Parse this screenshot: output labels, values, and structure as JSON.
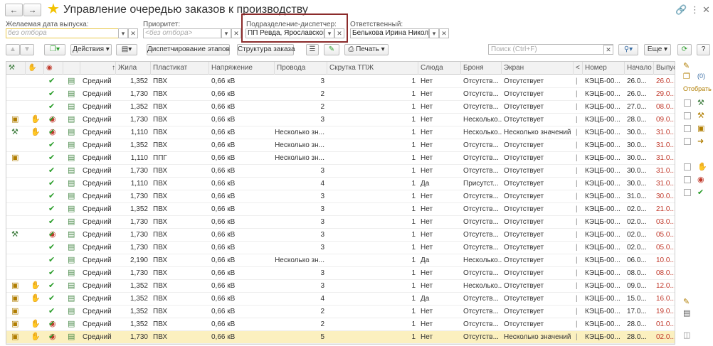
{
  "window": {
    "title": "Управление очередью заказов к производству",
    "back_icon": "arrow-left-icon",
    "forward_icon": "arrow-right-icon"
  },
  "filters": {
    "date": {
      "label": "Желаемая дата выпуска:",
      "placeholder": "без отбора"
    },
    "priority": {
      "label": "Приоритет:",
      "placeholder": "<без отбора>"
    },
    "department": {
      "label": "Подразделение-диспетчер:",
      "value": "ПП Ревда, Ярославского"
    },
    "responsible": {
      "label": "Ответственный:",
      "value": "Белькова Ирина Николаев"
    }
  },
  "toolbar": {
    "actions": "Действия",
    "dispatch": "Диспетчирование этапов",
    "structure": "Структура заказа",
    "print": "Печать",
    "search_placeholder": "Поиск (Ctrl+F)",
    "more": "Еще"
  },
  "columns": [
    "",
    "",
    "",
    "",
    "↑",
    "Жила",
    "Пластикат",
    "Напряжение",
    "Провода",
    "Скрутка ТПЖ",
    "Слюда",
    "Броня",
    "Экран",
    "<",
    "Номер",
    "Начало",
    "Выпуск"
  ],
  "rows": [
    {
      "i1": "",
      "i2": "",
      "i3": "",
      "prio": "Средний",
      "zhila": "1,352",
      "plast": "ПВХ",
      "volt": "0,66 кВ",
      "wires": "3",
      "twist": "1",
      "mica": "Нет",
      "armor": "Отсутств...",
      "screen": "Отсутствует",
      "num": "КЭЦБ-00...",
      "start": "26.0...",
      "release": "26.0..."
    },
    {
      "i1": "",
      "i2": "",
      "i3": "",
      "prio": "Средний",
      "zhila": "1,730",
      "plast": "ПВХ",
      "volt": "0,66 кВ",
      "wires": "2",
      "twist": "1",
      "mica": "Нет",
      "armor": "Отсутств...",
      "screen": "Отсутствует",
      "num": "КЭЦБ-00...",
      "start": "26.0...",
      "release": "29.0..."
    },
    {
      "i1": "",
      "i2": "",
      "i3": "",
      "prio": "Средний",
      "zhila": "1,352",
      "plast": "ПВХ",
      "volt": "0,66 кВ",
      "wires": "2",
      "twist": "1",
      "mica": "Нет",
      "armor": "Отсутств...",
      "screen": "Отсутствует",
      "num": "КЭЦБ-00...",
      "start": "27.0...",
      "release": "08.0..."
    },
    {
      "i1": "cal",
      "i2": "hand",
      "i3": "money",
      "prio": "Средний",
      "zhila": "1,730",
      "plast": "ПВХ",
      "volt": "0,66 кВ",
      "wires": "3",
      "twist": "1",
      "mica": "Нет",
      "armor": "Несколько...",
      "screen": "Отсутствует",
      "num": "КЭЦБ-00...",
      "start": "28.0...",
      "release": "09.0..."
    },
    {
      "i1": "tool",
      "i2": "hand",
      "i3": "money",
      "prio": "Средний",
      "zhila": "1,110",
      "plast": "ПВХ",
      "volt": "0,66 кВ",
      "wires": "Несколько зн...",
      "twist": "1",
      "mica": "Нет",
      "armor": "Несколько...",
      "screen": "Несколько значений",
      "num": "КЭЦБ-00...",
      "start": "30.0...",
      "release": "31.0..."
    },
    {
      "i1": "",
      "i2": "",
      "i3": "",
      "prio": "Средний",
      "zhila": "1,352",
      "plast": "ПВХ",
      "volt": "0,66 кВ",
      "wires": "Несколько зн...",
      "twist": "1",
      "mica": "Нет",
      "armor": "Отсутств...",
      "screen": "Отсутствует",
      "num": "КЭЦБ-00...",
      "start": "30.0...",
      "release": "31.0..."
    },
    {
      "i1": "cal",
      "i2": "",
      "i3": "",
      "prio": "Средний",
      "zhila": "1,110",
      "plast": "ППГ",
      "volt": "0,66 кВ",
      "wires": "Несколько зн...",
      "twist": "1",
      "mica": "Нет",
      "armor": "Отсутств...",
      "screen": "Отсутствует",
      "num": "КЭЦБ-00...",
      "start": "30.0...",
      "release": "31.0..."
    },
    {
      "i1": "",
      "i2": "",
      "i3": "",
      "prio": "Средний",
      "zhila": "1,730",
      "plast": "ПВХ",
      "volt": "0,66 кВ",
      "wires": "3",
      "twist": "1",
      "mica": "Нет",
      "armor": "Отсутств...",
      "screen": "Отсутствует",
      "num": "КЭЦБ-00...",
      "start": "30.0...",
      "release": "31.0..."
    },
    {
      "i1": "",
      "i2": "",
      "i3": "",
      "prio": "Средний",
      "zhila": "1,110",
      "plast": "ПВХ",
      "volt": "0,66 кВ",
      "wires": "4",
      "twist": "1",
      "mica": "Да",
      "armor": "Присутст...",
      "screen": "Отсутствует",
      "num": "КЭЦБ-00...",
      "start": "30.0...",
      "release": "31.0..."
    },
    {
      "i1": "",
      "i2": "",
      "i3": "",
      "prio": "Средний",
      "zhila": "1,730",
      "plast": "ПВХ",
      "volt": "0,66 кВ",
      "wires": "3",
      "twist": "1",
      "mica": "Нет",
      "armor": "Отсутств...",
      "screen": "Отсутствует",
      "num": "КЭЦБ-00...",
      "start": "31.0...",
      "release": "30.0..."
    },
    {
      "i1": "",
      "i2": "",
      "i3": "",
      "prio": "Средний",
      "zhila": "1,352",
      "plast": "ПВХ",
      "volt": "0,66 кВ",
      "wires": "3",
      "twist": "1",
      "mica": "Нет",
      "armor": "Отсутств...",
      "screen": "Отсутствует",
      "num": "КЭЦБ-00...",
      "start": "02.0...",
      "release": "21.0..."
    },
    {
      "i1": "",
      "i2": "",
      "i3": "",
      "prio": "Средний",
      "zhila": "1,730",
      "plast": "ПВХ",
      "volt": "0,66 кВ",
      "wires": "3",
      "twist": "1",
      "mica": "Нет",
      "armor": "Отсутств...",
      "screen": "Отсутствует",
      "num": "КЭЦБ-00...",
      "start": "02.0...",
      "release": "03.0..."
    },
    {
      "i1": "tool",
      "i2": "",
      "i3": "money",
      "prio": "Средний",
      "zhila": "1,730",
      "plast": "ПВХ",
      "volt": "0,66 кВ",
      "wires": "3",
      "twist": "1",
      "mica": "Нет",
      "armor": "Отсутств...",
      "screen": "Отсутствует",
      "num": "КЭЦБ-00...",
      "start": "02.0...",
      "release": "05.0..."
    },
    {
      "i1": "",
      "i2": "",
      "i3": "",
      "prio": "Средний",
      "zhila": "1,730",
      "plast": "ПВХ",
      "volt": "0,66 кВ",
      "wires": "3",
      "twist": "1",
      "mica": "Нет",
      "armor": "Отсутств...",
      "screen": "Отсутствует",
      "num": "КЭЦБ-00...",
      "start": "02.0...",
      "release": "05.0..."
    },
    {
      "i1": "",
      "i2": "",
      "i3": "",
      "prio": "Средний",
      "zhila": "2,190",
      "plast": "ПВХ",
      "volt": "0,66 кВ",
      "wires": "Несколько зн...",
      "twist": "1",
      "mica": "Да",
      "armor": "Несколько...",
      "screen": "Отсутствует",
      "num": "КЭЦБ-00...",
      "start": "06.0...",
      "release": "10.0..."
    },
    {
      "i1": "",
      "i2": "",
      "i3": "",
      "prio": "Средний",
      "zhila": "1,730",
      "plast": "ПВХ",
      "volt": "0,66 кВ",
      "wires": "3",
      "twist": "1",
      "mica": "Нет",
      "armor": "Отсутств...",
      "screen": "Отсутствует",
      "num": "КЭЦБ-00...",
      "start": "08.0...",
      "release": "08.0..."
    },
    {
      "i1": "cal",
      "i2": "hand",
      "i3": "",
      "prio": "Средний",
      "zhila": "1,352",
      "plast": "ПВХ",
      "volt": "0,66 кВ",
      "wires": "3",
      "twist": "1",
      "mica": "Нет",
      "armor": "Несколько...",
      "screen": "Отсутствует",
      "num": "КЭЦБ-00...",
      "start": "09.0...",
      "release": "12.0..."
    },
    {
      "i1": "cal",
      "i2": "hand",
      "i3": "",
      "prio": "Средний",
      "zhila": "1,352",
      "plast": "ПВХ",
      "volt": "0,66 кВ",
      "wires": "4",
      "twist": "1",
      "mica": "Да",
      "armor": "Отсутств...",
      "screen": "Отсутствует",
      "num": "КЭЦБ-00...",
      "start": "15.0...",
      "release": "16.0..."
    },
    {
      "i1": "cal",
      "i2": "",
      "i3": "",
      "prio": "Средний",
      "zhila": "1,352",
      "plast": "ПВХ",
      "volt": "0,66 кВ",
      "wires": "2",
      "twist": "1",
      "mica": "Нет",
      "armor": "Отсутств...",
      "screen": "Отсутствует",
      "num": "КЭЦБ-00...",
      "start": "17.0...",
      "release": "19.0..."
    },
    {
      "i1": "cal",
      "i2": "hand",
      "i3": "money",
      "prio": "Средний",
      "zhila": "1,352",
      "plast": "ПВХ",
      "volt": "0,66 кВ",
      "wires": "2",
      "twist": "1",
      "mica": "Нет",
      "armor": "Отсутств...",
      "screen": "Отсутствует",
      "num": "КЭЦБ-00...",
      "start": "28.0...",
      "release": "01.0..."
    },
    {
      "i1": "cal",
      "i2": "hand",
      "i3": "money",
      "prio": "Средний",
      "zhila": "1,730",
      "plast": "ПВХ",
      "volt": "0,66 кВ",
      "wires": "5",
      "twist": "1",
      "mica": "Нет",
      "armor": "Отсутств...",
      "screen": "Несколько значений",
      "num": "КЭЦБ-00...",
      "start": "28.0...",
      "release": "02.0..."
    }
  ],
  "selected_row": 20,
  "right_panel": {
    "count": "(0)",
    "filter_label": "Отобрать"
  },
  "colors": {
    "accent": "#8b2b2b",
    "check": "#2a9d2a",
    "release_red": "#c0392b",
    "selected_row": "#fbf0bf",
    "star": "#f2c200"
  }
}
